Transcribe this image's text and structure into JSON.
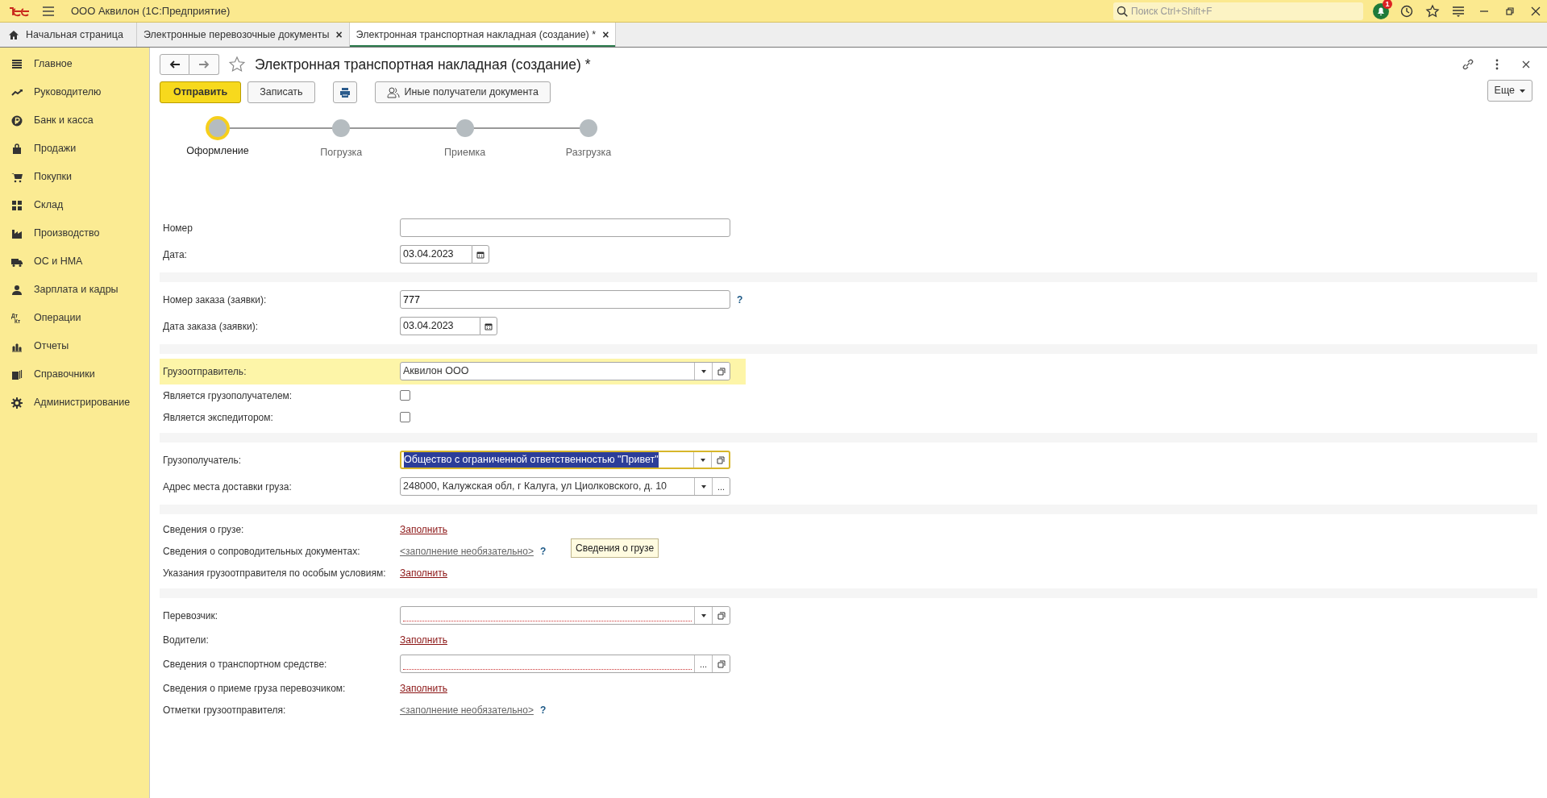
{
  "app": {
    "title": "ООО Аквилон  (1С:Предприятие)",
    "search": {
      "placeholder": "Поиск Ctrl+Shift+F"
    },
    "notifications": "1"
  },
  "open_tabs": [
    {
      "label": "Начальная страница",
      "selected": false,
      "kind": "home"
    },
    {
      "label": "Электронные перевозочные документы",
      "selected": false,
      "kind": "document",
      "close": "×"
    },
    {
      "label": "Электронная транспортная накладная (создание) *",
      "selected": true,
      "kind": "document",
      "close": "×"
    }
  ],
  "sidebar": {
    "items": [
      {
        "label": "Главное"
      },
      {
        "label": "Руководителю"
      },
      {
        "label": "Банк и касса"
      },
      {
        "label": "Продажи"
      },
      {
        "label": "Покупки"
      },
      {
        "label": "Склад"
      },
      {
        "label": "Производство"
      },
      {
        "label": "ОС и НМА"
      },
      {
        "label": "Зарплата и кадры"
      },
      {
        "label": "Операции",
        "icon_text": [
          "Дт",
          "Кт"
        ]
      },
      {
        "label": "Отчеты"
      },
      {
        "label": "Справочники"
      },
      {
        "label": "Администрирование"
      }
    ]
  },
  "document": {
    "title": "Электронная транспортная накладная (создание) *",
    "buttons": [
      {
        "label": "Отправить",
        "kind": "primary"
      },
      {
        "label": "Записать",
        "kind": "default"
      },
      {
        "kind": "print"
      },
      {
        "label": "Иные получатели документа",
        "kind": "people"
      }
    ],
    "more_button": "Еще",
    "steps": [
      {
        "label": "Оформление",
        "selected": true
      },
      {
        "label": "Погрузка",
        "selected": false
      },
      {
        "label": "Приемка",
        "selected": false
      },
      {
        "label": "Разгрузка",
        "selected": false
      }
    ],
    "sections": [
      {
        "rows": [
          {
            "kind": "text",
            "label": "Номер"
          },
          {
            "kind": "date",
            "label": "Дата:",
            "value": "03.04.2023"
          }
        ]
      },
      {
        "rows": [
          {
            "kind": "text",
            "label": "Номер заказа (заявки):",
            "value": "777",
            "help": "?"
          },
          {
            "kind": "date",
            "label": "Дата заказа (заявки):",
            "value": "03.04.2023"
          }
        ]
      },
      {
        "rows": [
          {
            "kind": "select",
            "label": "Грузоотправитель:",
            "value": "Аквилон ООО",
            "highlighted": true,
            "buttons": [
              {
                "kind": "dropdown"
              },
              {
                "kind": "open"
              }
            ]
          },
          {
            "kind": "checkbox",
            "label": "Является грузополучателем:",
            "checked": false
          },
          {
            "kind": "checkbox",
            "label": "Является экспедитором:",
            "checked": false
          }
        ]
      },
      {
        "rows": [
          {
            "kind": "select",
            "label": "Грузополучатель:",
            "value": "Общество с ограниченной ответственностью \"Привет\"",
            "focused": true,
            "text_selected": true,
            "buttons": [
              {
                "kind": "dropdown"
              },
              {
                "kind": "open"
              }
            ]
          },
          {
            "kind": "select",
            "label": "Адрес места доставки груза:",
            "value": "248000, Калужская обл, г Калуга, ул Циолковского, д. 10",
            "buttons": [
              {
                "kind": "dropdown"
              },
              {
                "kind": "choose",
                "text": "..."
              }
            ]
          }
        ]
      },
      {
        "rows": [
          {
            "kind": "link",
            "label": "Сведения о грузе:",
            "value": "Заполнить",
            "tooltip": "Сведения о грузе"
          },
          {
            "kind": "optional_link",
            "label": "Сведения о сопроводительных документах:",
            "value": "<заполнение необязательно>",
            "help": "?"
          },
          {
            "kind": "link",
            "label": "Указания грузоотправителя по особым условиям:",
            "value": "Заполнить"
          }
        ]
      },
      {
        "rows": [
          {
            "kind": "select",
            "label": "Перевозчик:",
            "required_empty": true,
            "buttons": [
              {
                "kind": "dropdown"
              },
              {
                "kind": "open"
              }
            ]
          },
          {
            "kind": "link",
            "label": "Водители:",
            "value": "Заполнить"
          },
          {
            "kind": "select",
            "label": "Сведения о транспортном средстве:",
            "required_empty": true,
            "buttons": [
              {
                "kind": "choose",
                "text": "..."
              },
              {
                "kind": "open"
              }
            ]
          },
          {
            "kind": "link",
            "label": "Сведения о приеме груза перевозчиком:",
            "value": "Заполнить"
          },
          {
            "kind": "optional_link",
            "label": "Отметки грузоотправителя:",
            "value": "<заполнение необязательно>",
            "help": "?"
          }
        ]
      }
    ]
  }
}
